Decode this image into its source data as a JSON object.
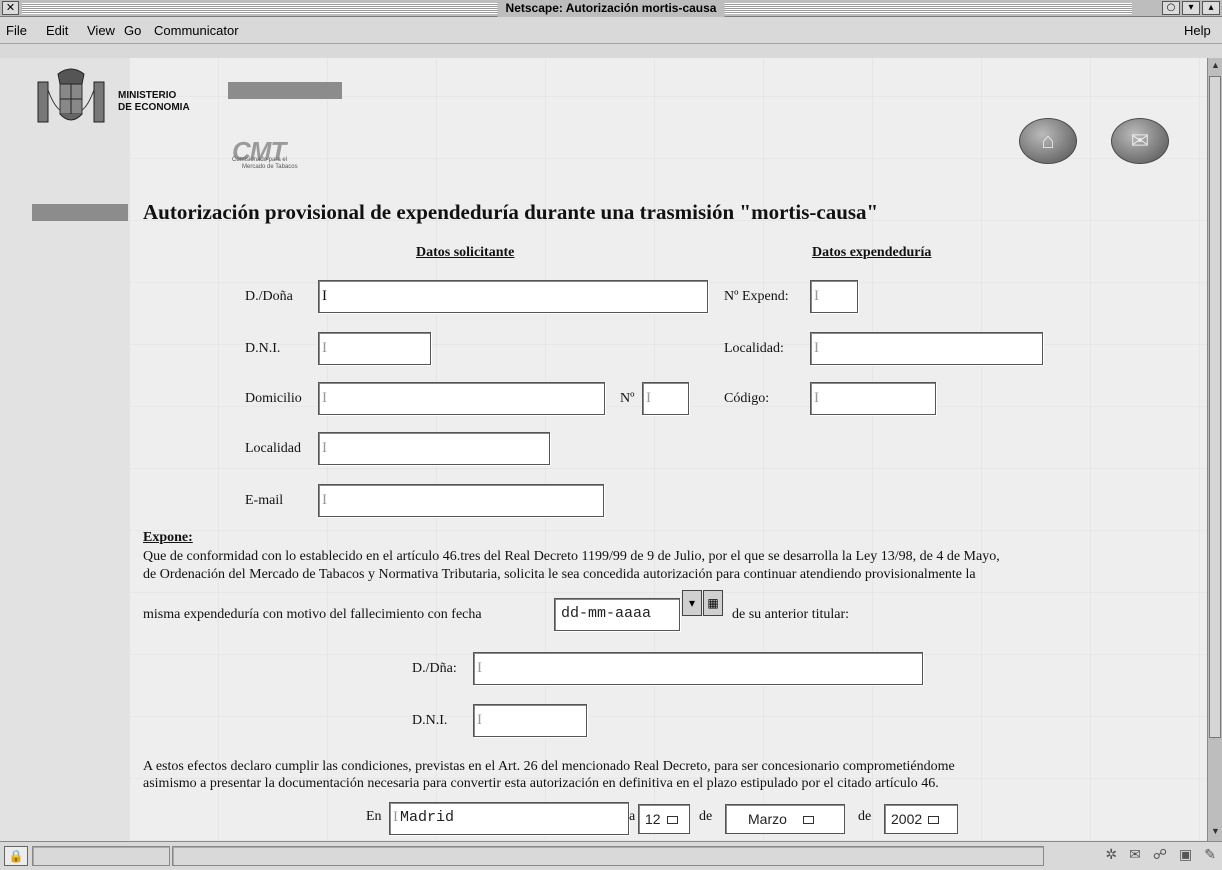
{
  "window": {
    "title": "Netscape: Autorización mortis-causa",
    "close_glyph": "✕",
    "buttons": [
      "○",
      "▾",
      "▴"
    ]
  },
  "menu": {
    "file": "File",
    "edit": "Edit",
    "view": "View",
    "go": "Go",
    "communicator": "Communicator",
    "help": "Help"
  },
  "header": {
    "ministry_line1": "MINISTERIO",
    "ministry_line2": "DE ECONOMIA",
    "cmt_letters": "CMT",
    "cmt_small_line1": "Comisionado para el",
    "cmt_small_line2": "Mercado de Tabacos",
    "home_icon": "home-icon",
    "mail_icon": "mail-icon"
  },
  "page": {
    "title": "Autorización provisional de expendeduría durante una trasmisión \"mortis-causa\""
  },
  "solicitante": {
    "heading": "Datos solicitante",
    "nombre_label": "D./Doña",
    "nombre_value": "",
    "dni_label": "D.N.I.",
    "dni_value": "",
    "domicilio_label": "Domicilio",
    "domicilio_value": "",
    "numero_label": "Nº",
    "numero_value": "",
    "localidad_label": "Localidad",
    "localidad_value": "",
    "email_label": "E-mail",
    "email_value": ""
  },
  "expendeduria": {
    "heading": "Datos expendeduría",
    "num_label": "Nº Expend:",
    "num_value": "",
    "localidad_label": "Localidad:",
    "localidad_value": "",
    "codigo_label": "Código:",
    "codigo_value": ""
  },
  "expone": {
    "heading": "Expone:",
    "line1": "Que de conformidad con lo establecido en el artículo 46.tres del Real Decreto 1199/99 de 9 de Julio, por el que se desarrolla la Ley 13/98, de 4 de Mayo,",
    "line2": "de Ordenación del Mercado de Tabacos y Normativa Tributaria, solicita le sea concedida autorización para continuar atendiendo provisionalmente la",
    "line3_pre": "misma expendeduría con motivo del fallecimiento con fecha",
    "date_value": "dd-mm-aaaa",
    "line3_post": "de su anterior titular:"
  },
  "titular": {
    "nombre_label": "D./Dña:",
    "nombre_value": "",
    "dni_label": "D.N.I.",
    "dni_value": ""
  },
  "declaracion": {
    "line1": "A estos efectos declaro cumplir las condiciones, previstas en el Art. 26 del mencionado Real Decreto, para ser concesionario comprometiéndome",
    "line2": "asimismo a presentar la documentación necesaria para convertir esta autorización en definitiva en el plazo estipulado por el citado artículo 46."
  },
  "firma": {
    "en_label": "En",
    "city_value": "Madrid",
    "a_label": "a",
    "day_value": "12",
    "de1_label": "de",
    "month_value": "Marzo",
    "de2_label": "de",
    "year_value": "2002"
  }
}
